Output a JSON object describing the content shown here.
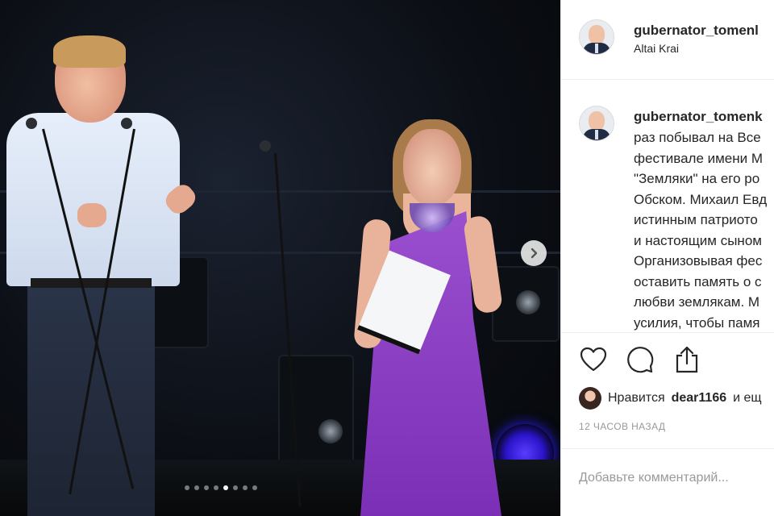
{
  "header": {
    "username": "gubernator_tomenl",
    "location": "Altai Krai",
    "avatar_icon": "profile-avatar"
  },
  "caption": {
    "username": "gubernator_tomenk",
    "lines": [
      "раз побывал на Все",
      "фестивале имени М",
      "\"Земляки\" на его ро",
      "Обском. Михаил Евд",
      "истинным патриото",
      "и настоящим сыном",
      "Организовывая фес",
      "оставить память о с",
      "любви землякам. М",
      "усилия, чтобы памя"
    ]
  },
  "actions": {
    "like_icon": "heart-icon",
    "comment_icon": "comment-icon",
    "share_icon": "share-icon"
  },
  "likes": {
    "prefix": "Нравится",
    "user": "dear1166",
    "suffix": "и ещ"
  },
  "timestamp": "12 ЧАСОВ НАЗАД",
  "comment_placeholder": "Добавьте комментарий...",
  "carousel": {
    "total": 8,
    "active_index": 4
  },
  "colors": {
    "text": "#262626",
    "muted": "#999999",
    "dress": "#8a3fc4",
    "stage_light": "#2a14c8"
  }
}
